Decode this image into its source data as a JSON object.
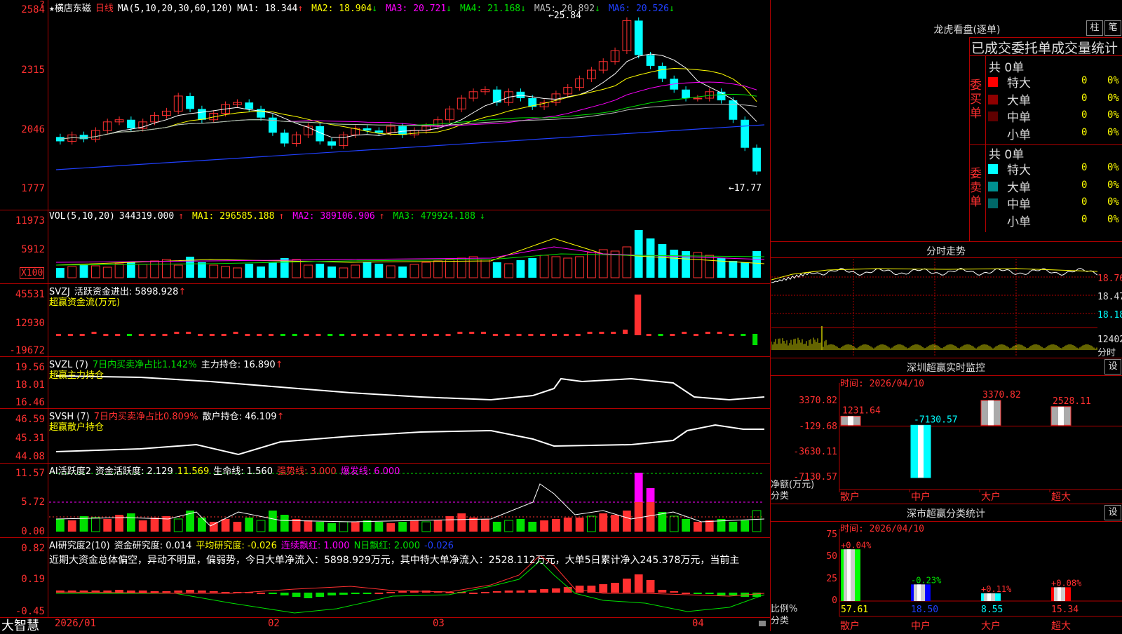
{
  "kline": {
    "star": "★",
    "stock_name": "横店东磁",
    "period": "日线",
    "ma_params": "MA(5,10,20,30,60,120)",
    "ma_values": [
      {
        "label": "MA1: 18.344",
        "arrow": "↑",
        "color": "#ffffff"
      },
      {
        "label": "MA2: 18.904",
        "arrow": "↓",
        "color": "#ffff00"
      },
      {
        "label": "MA3: 20.721",
        "arrow": "↓",
        "color": "#ff00ff"
      },
      {
        "label": "MA4: 21.168",
        "arrow": "↓",
        "color": "#00e000"
      },
      {
        "label": "MA5: 20.892",
        "arrow": "↓",
        "color": "#bbbbbb"
      },
      {
        "label": "MA6: 20.526",
        "arrow": "↓",
        "color": "#2040ff"
      }
    ],
    "y_labels": [
      "2584",
      "2315",
      "2046",
      "1777"
    ],
    "corner_mark": "?",
    "high_label": "25.84",
    "low_label": "17.77"
  },
  "volume": {
    "params": "VOL(5,10,20)",
    "value": "344319.000",
    "value_arrow": "↑",
    "ma1": "MA1: 296585.188",
    "ma1_arrow": "↑",
    "ma2": "MA2: 389106.906",
    "ma2_arrow": "↑",
    "ma3": "MA3: 479924.188",
    "ma3_arrow": "↓",
    "y_labels": [
      "11973",
      "5912"
    ],
    "unit": "X100"
  },
  "svzj": {
    "name": "SVZJ",
    "line1": "活跃资金进出: 5898.928",
    "line1_arrow": "↑",
    "line2": "超赢资金流(万元)",
    "y_labels": [
      "45531",
      "12930",
      "-19672"
    ]
  },
  "svzl": {
    "name": "SVZL (7)",
    "part1": "7日内买卖净占比1.142%",
    "part2": "主力持仓: 16.890",
    "arrow": "↑",
    "line2": "超赢主力持仓",
    "y_labels": [
      "19.56",
      "18.01",
      "16.46"
    ]
  },
  "svsh": {
    "name": "SVSH (7)",
    "part1": "7日内买卖净占比0.809%",
    "part2": "散户持仓: 46.109",
    "arrow": "↑",
    "line2": "超赢散户持仓",
    "y_labels": [
      "46.59",
      "45.31",
      "44.08"
    ]
  },
  "ai_active": {
    "name": "AI活跃度2",
    "part1": "资金活跃度: 2.129",
    "part2": "11.569",
    "part3": "生命线: 1.560",
    "part4": "强势线: 3.000",
    "part5": "爆发线: 6.000",
    "y_labels": [
      "11.57",
      "5.72",
      "0.00"
    ]
  },
  "ai_research": {
    "name": "AI研究度2(10)",
    "part1": "资金研究度: 0.014",
    "part2": "平均研究度: -0.026",
    "part3": "连续飘红: 1.000",
    "part4": "N日飘红: 2.000",
    "part5": "-0.026",
    "comment": "近期大资金总体偏空，异动不明显，偏弱势，今日大单净流入：5898.929万元，其中特大单净流入：2528.112万元，大单5日累计净入245.378万元，当前主",
    "y_labels": [
      "0.82",
      "0.19",
      "-0.45"
    ]
  },
  "xaxis": {
    "brand": "大智慧",
    "labels": [
      "2026/01",
      "02",
      "03",
      "04"
    ]
  },
  "dragon": {
    "title": "龙虎看盘(逐单)",
    "btn1": "柱",
    "btn2": "笔",
    "table_title": "已成交委托单成交量统计",
    "buy_side": "委买单",
    "sell_side": "委卖单",
    "buy_total": "共 0单",
    "sell_total": "共 0单",
    "buy_rows": [
      {
        "name": "特大",
        "val": "0",
        "pct": "0%",
        "color": "#ff0000"
      },
      {
        "name": "大单",
        "val": "0",
        "pct": "0%",
        "color": "#900000"
      },
      {
        "name": "中单",
        "val": "0",
        "pct": "0%",
        "color": "#600000"
      },
      {
        "name": "小单",
        "val": "0",
        "pct": "0%",
        "color": "#000000"
      }
    ],
    "sell_rows": [
      {
        "name": "特大",
        "val": "0",
        "pct": "0%",
        "color": "#00ffff"
      },
      {
        "name": "大单",
        "val": "0",
        "pct": "0%",
        "color": "#008f8f"
      },
      {
        "name": "中单",
        "val": "0",
        "pct": "0%",
        "color": "#006868"
      },
      {
        "name": "小单",
        "val": "0",
        "pct": "0%",
        "color": "#000000"
      }
    ]
  },
  "intraday": {
    "title": "分时走势",
    "y_labels": [
      "18.76",
      "18.47",
      "18.18",
      "12402"
    ],
    "unit": "分时"
  },
  "monitor": {
    "title": "深圳超赢实时监控",
    "btn": "设",
    "time": "时间: 2026/04/10",
    "y_labels": [
      "3370.82",
      "-129.68",
      "-3630.11",
      "-7130.57"
    ],
    "axis_label": "净额(万元)",
    "cat_label": "分类",
    "categories": [
      "散户",
      "中户",
      "大户",
      "超大"
    ],
    "values": [
      1231.64,
      -7130.57,
      3370.82,
      2528.11
    ],
    "value_labels": [
      "1231.64",
      "-7130.57",
      "3370.82",
      "2528.11"
    ]
  },
  "classify": {
    "title": "深市超赢分类统计",
    "btn": "设",
    "time": "时间: 2026/04/10",
    "y_labels": [
      "75",
      "50",
      "25",
      "0"
    ],
    "axis_label": "比例%",
    "cat_label": "分类",
    "categories": [
      "散户",
      "中户",
      "大户",
      "超大"
    ],
    "values": [
      57.61,
      18.5,
      8.55,
      15.34
    ],
    "value_labels": [
      "57.61",
      "18.50",
      "8.55",
      "15.34"
    ],
    "changes": [
      "+0.04%",
      "-0.23%",
      "+0.11%",
      "+0.08%"
    ],
    "bar_colors": [
      "#00ff00",
      "#0000ff",
      "#00ffff",
      "#ff0000"
    ]
  },
  "colors": {
    "up": "#ff3030",
    "down": "#00ffff",
    "border": "#b00000"
  }
}
